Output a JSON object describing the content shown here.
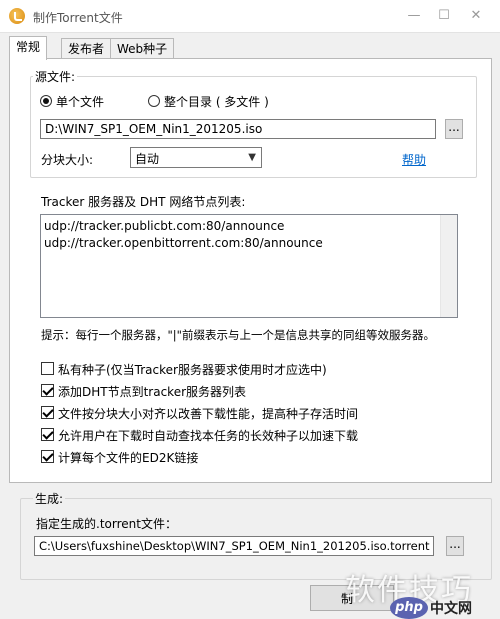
{
  "window": {
    "title": "制作Torrent文件",
    "minimize": "—",
    "maximize": "☐",
    "close": "✕"
  },
  "tabs": [
    "常规",
    "发布者",
    "Web种子"
  ],
  "source": {
    "group_label": "源文件:",
    "single_file": "单个文件",
    "whole_dir": "整个目录 ( 多文件 )",
    "path": "D:\\WIN7_SP1_OEM_Nin1_201205.iso",
    "browse": "...",
    "piece_size_label": "分块大小:",
    "piece_size_value": "自动",
    "help": "帮助"
  },
  "tracker": {
    "label": "Tracker 服务器及 DHT 网络节点列表:",
    "lines": [
      "udp://tracker.publicbt.com:80/announce",
      "udp://tracker.openbittorrent.com:80/announce"
    ],
    "hint": "提示：每行一个服务器，\"|\"前缀表示与上一个是信息共享的同组等效服务器。"
  },
  "options": [
    {
      "label": "私有种子(仅当Tracker服务器要求使用时才应选中)",
      "checked": false
    },
    {
      "label": "添加DHT节点到tracker服务器列表",
      "checked": true
    },
    {
      "label": "文件按分块大小对齐以改善下载性能，提高种子存活时间",
      "checked": true
    },
    {
      "label": "允许用户在下载时自动查找本任务的长效种子以加速下载",
      "checked": true
    },
    {
      "label": "计算每个文件的ED2K链接",
      "checked": true
    }
  ],
  "output": {
    "group_label": "生成:",
    "file_label": "指定生成的.torrent文件：",
    "path": "C:\\Users\\fuxshine\\Desktop\\WIN7_SP1_OEM_Nin1_201205.iso.torrent",
    "browse": "..."
  },
  "buttons": {
    "make": "制"
  },
  "watermark": {
    "text": "软件技巧",
    "logo": "php",
    "site": "中文网"
  }
}
